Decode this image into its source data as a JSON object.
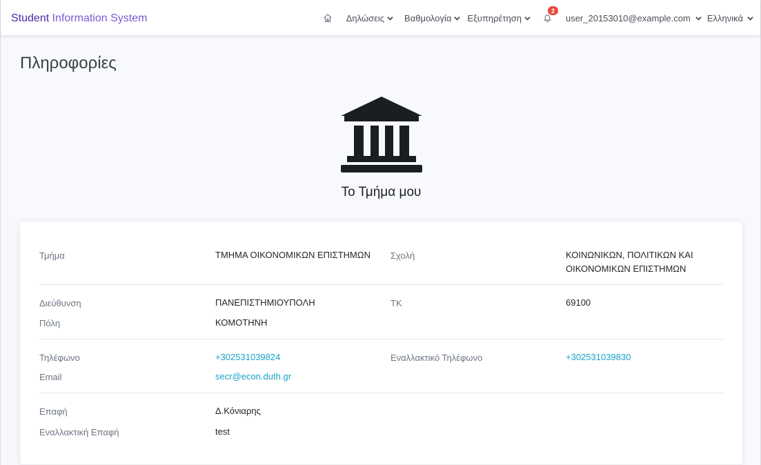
{
  "navbar": {
    "brand_part1": "Student",
    "brand_part2": "Information System",
    "menu": [
      {
        "label": "Δηλώσεις"
      },
      {
        "label": "Βαθμολογία"
      },
      {
        "label": "Εξυπηρέτηση"
      }
    ],
    "notification_count": "2",
    "user_email": "user_20153010@example.com",
    "language": "Ελληνικά"
  },
  "page": {
    "title": "Πληροφορίες",
    "dept_caption": "Το Τμήμα μου"
  },
  "info": {
    "department_label": "Τμήμα",
    "department_value": "ΤΜΗΜΑ ΟΙΚΟΝΟΜΙΚΩΝ ΕΠΙΣΤΗΜΩΝ",
    "school_label": "Σχολή",
    "school_value_line1": "ΚΟΙΝΩΝΙΚΩΝ, ΠΟΛΙΤΙΚΩΝ ΚΑΙ",
    "school_value_line2": "ΟΙΚΟΝΟΜΙΚΩΝ ΕΠΙΣΤΗΜΩΝ",
    "address_label": "Διεύθυνση",
    "address_value": "ΠΑΝΕΠΙΣΤΗΜΙΟΥΠΟΛΗ",
    "postal_label": "ΤΚ",
    "postal_value": "69100",
    "city_label": "Πόλη",
    "city_value": "ΚΟΜΟΤΗΝΗ",
    "phone_label": "Τηλέφωνο",
    "phone_value": "+302531039824",
    "alt_phone_label": "Εναλλακτικό Τηλέφωνο",
    "alt_phone_value": "+302531039830",
    "email_label": "Email",
    "email_value": "secr@econ.duth.gr",
    "contact_label": "Επαφή",
    "contact_value": "Δ.Κόνιαρης",
    "alt_contact_label": "Εναλλακτική Επαφή",
    "alt_contact_value": "test"
  },
  "colors": {
    "brand": "#6f42c1",
    "link": "#17a2c8",
    "badge": "#e74a3b"
  }
}
